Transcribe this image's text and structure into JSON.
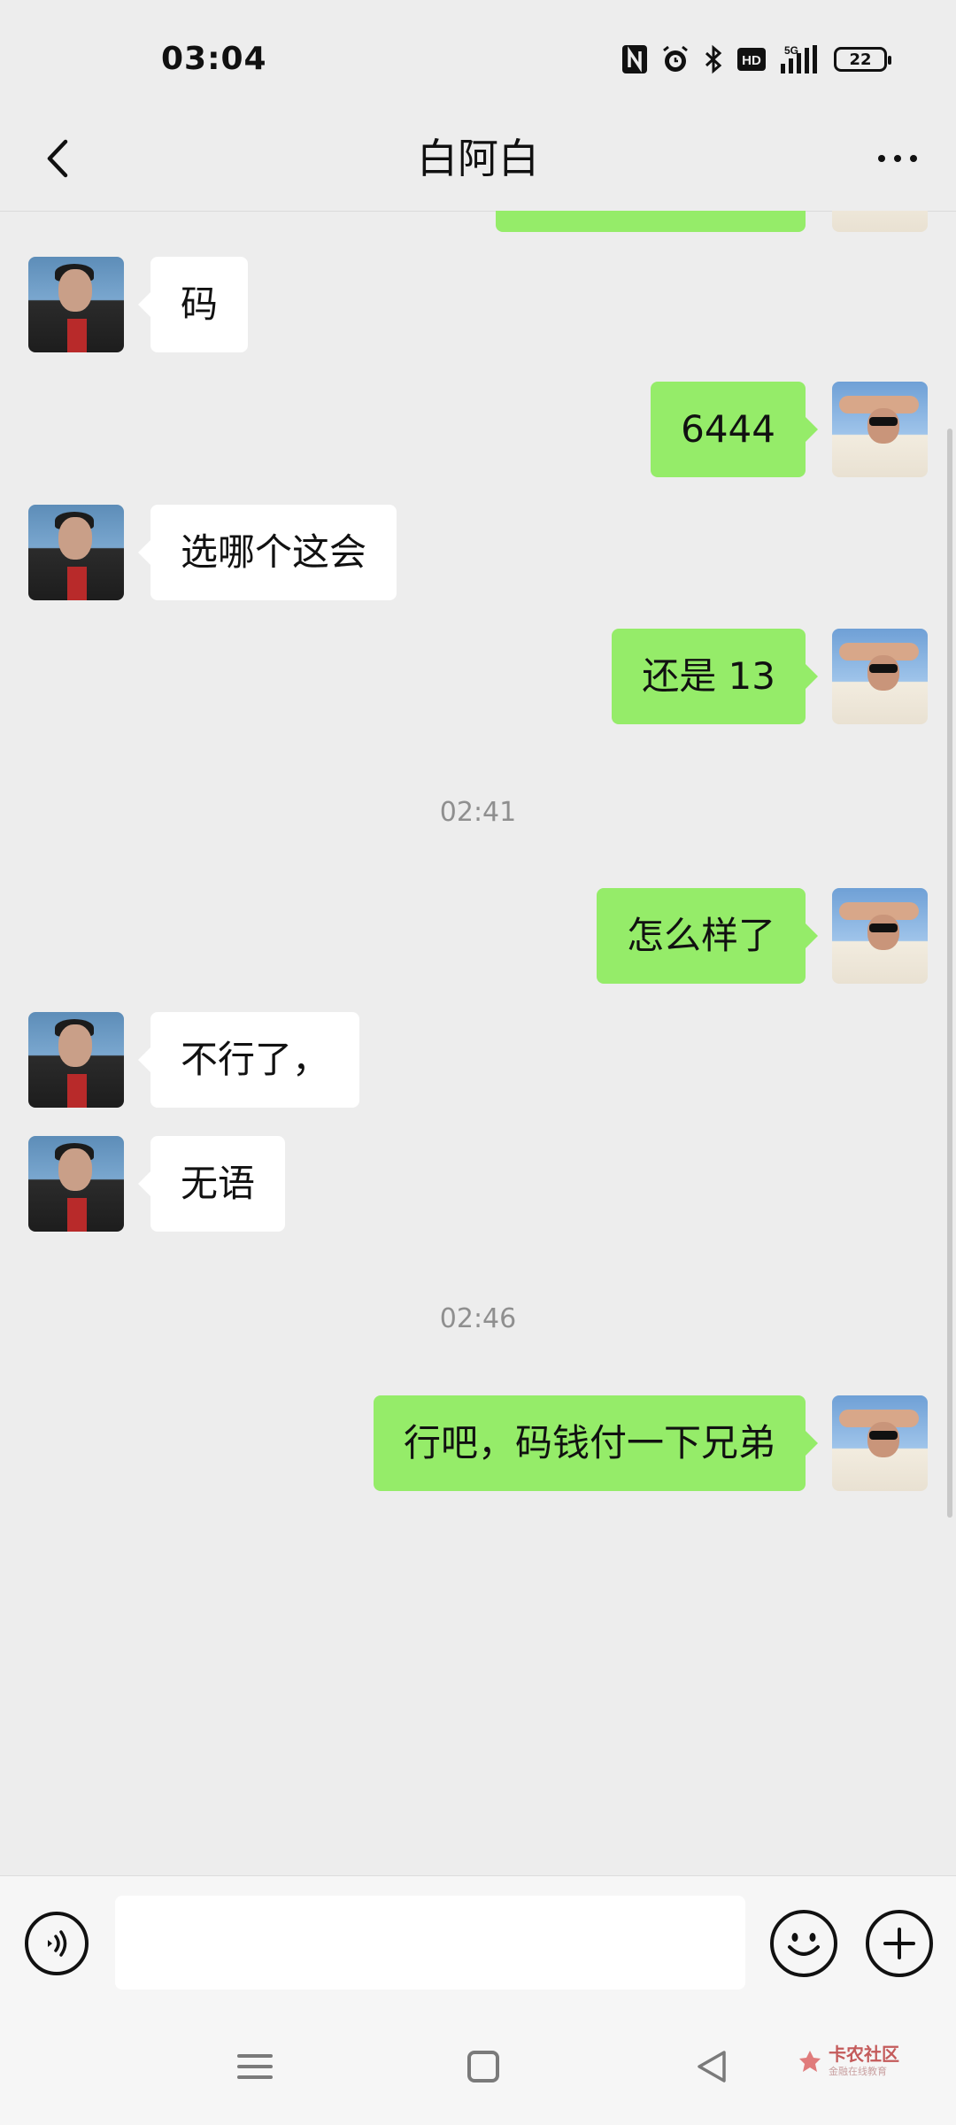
{
  "status_bar": {
    "time": "03:04",
    "network": "5G",
    "battery": "22",
    "icons": [
      "nfc-icon",
      "alarm-icon",
      "bluetooth-icon",
      "hd-icon",
      "signal-icon",
      "battery-icon"
    ],
    "hd_label": "HD"
  },
  "header": {
    "title": "白阿白",
    "back_icon": "chevron-left-icon",
    "more_icon": "more-dots-icon"
  },
  "messages": [
    {
      "side": "left",
      "text": "码"
    },
    {
      "side": "right",
      "text": "6444"
    },
    {
      "side": "left",
      "text": "选哪个这会"
    },
    {
      "side": "right",
      "text": "还是 13"
    },
    {
      "time": "02:41"
    },
    {
      "side": "right",
      "text": "怎么样了"
    },
    {
      "side": "left",
      "text": "不行了，"
    },
    {
      "side": "left",
      "text": "无语"
    },
    {
      "time": "02:46"
    },
    {
      "side": "right",
      "text": "行吧，码钱付一下兄弟"
    }
  ],
  "input_bar": {
    "voice_icon": "voice-icon",
    "placeholder": "",
    "emoji_icon": "emoji-icon",
    "plus_icon": "plus-icon"
  },
  "nav_bar": {
    "icons": [
      "menu-icon",
      "home-icon",
      "back-triangle-icon"
    ]
  },
  "watermark": {
    "main": "卡农社区",
    "sub": "金融在线教育"
  },
  "colors": {
    "background": "#ededed",
    "sent_bubble": "#95ec69",
    "received_bubble": "#ffffff",
    "timestamp": "#8f8f8f"
  }
}
